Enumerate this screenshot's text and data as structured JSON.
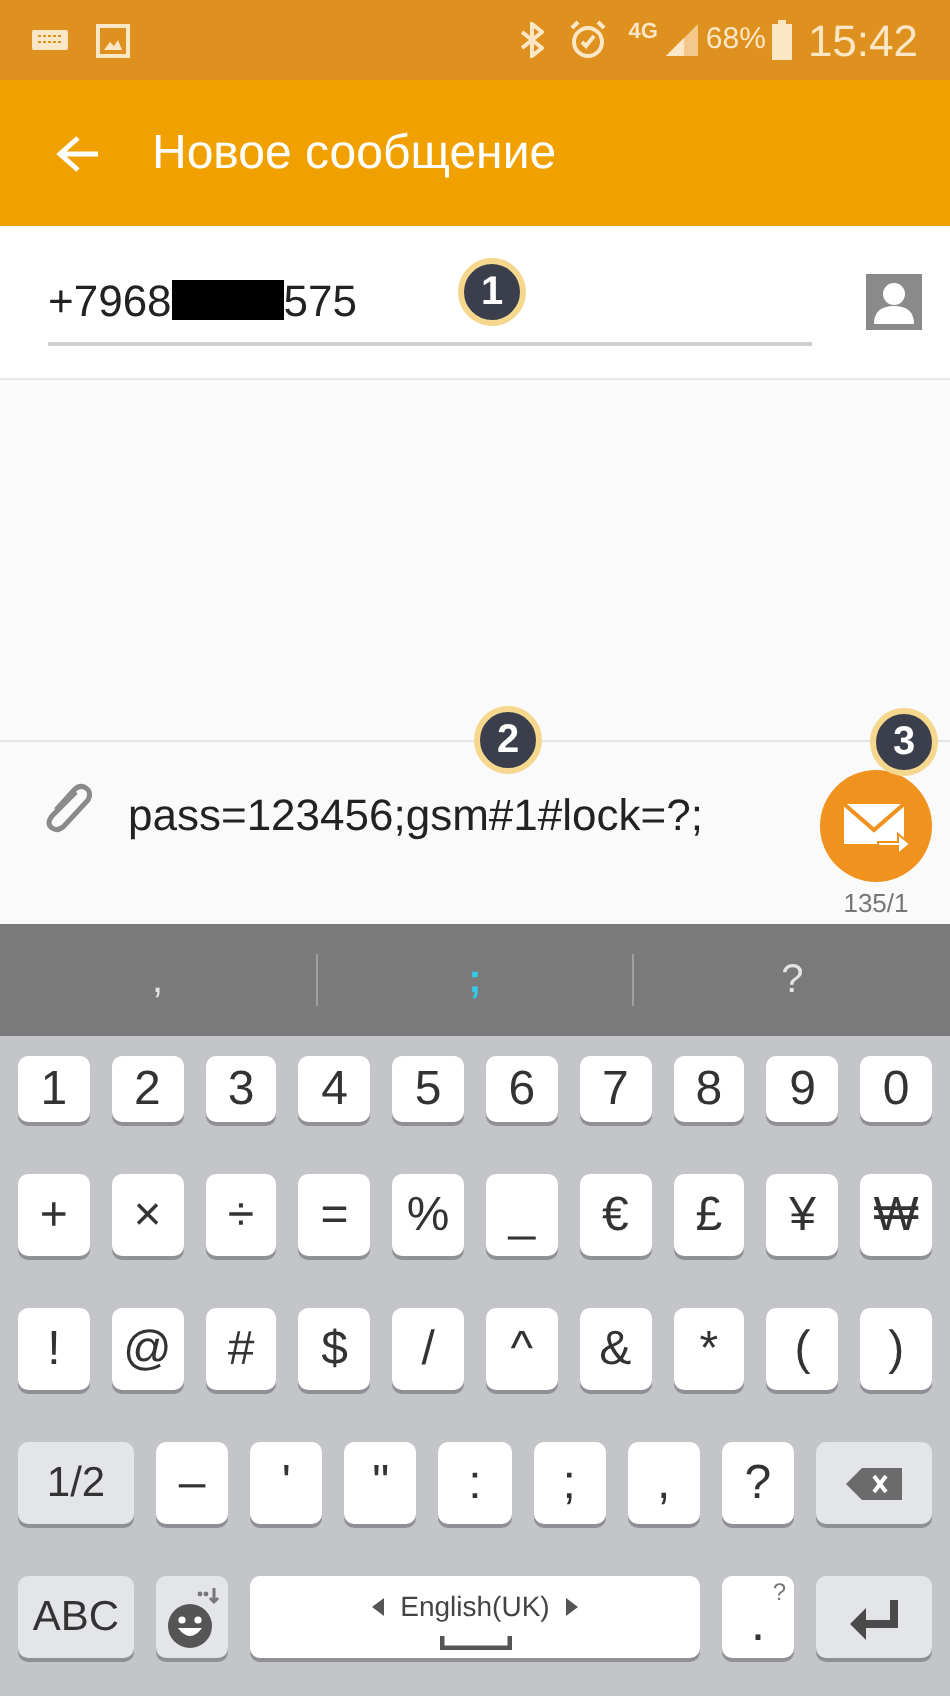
{
  "status_bar": {
    "network": "4G",
    "battery": "68%",
    "time": "15:42"
  },
  "app_bar": {
    "title": "Новое сообщение"
  },
  "recipient": {
    "number_start": "+7968",
    "number_end": "575"
  },
  "composer": {
    "message": "pass=123456;gsm#1#lock=?;",
    "counter": "135/1"
  },
  "annotations": [
    {
      "label": "1"
    },
    {
      "label": "2"
    },
    {
      "label": "3"
    }
  ],
  "suggestions": [
    {
      "text": ",",
      "selected": false
    },
    {
      "text": ";",
      "selected": true
    },
    {
      "text": "?",
      "selected": false
    }
  ],
  "keyboard": {
    "rows": [
      {
        "keys": [
          {
            "label": "1",
            "kind": "char"
          },
          {
            "label": "2",
            "kind": "char"
          },
          {
            "label": "3",
            "kind": "char"
          },
          {
            "label": "4",
            "kind": "char"
          },
          {
            "label": "5",
            "kind": "char"
          },
          {
            "label": "6",
            "kind": "char"
          },
          {
            "label": "7",
            "kind": "char"
          },
          {
            "label": "8",
            "kind": "char"
          },
          {
            "label": "9",
            "kind": "char"
          },
          {
            "label": "0",
            "kind": "char"
          }
        ]
      },
      {
        "keys": [
          {
            "label": "+",
            "kind": "char"
          },
          {
            "label": "×",
            "kind": "char"
          },
          {
            "label": "÷",
            "kind": "char"
          },
          {
            "label": "=",
            "kind": "char"
          },
          {
            "label": "%",
            "kind": "char"
          },
          {
            "label": "_",
            "kind": "char"
          },
          {
            "label": "€",
            "kind": "char"
          },
          {
            "label": "£",
            "kind": "char"
          },
          {
            "label": "¥",
            "kind": "char"
          },
          {
            "label": "₩",
            "kind": "char"
          }
        ]
      },
      {
        "keys": [
          {
            "label": "!",
            "kind": "char"
          },
          {
            "label": "@",
            "kind": "char"
          },
          {
            "label": "#",
            "kind": "char"
          },
          {
            "label": "$",
            "kind": "char"
          },
          {
            "label": "/",
            "kind": "char"
          },
          {
            "label": "^",
            "kind": "char"
          },
          {
            "label": "&",
            "kind": "char"
          },
          {
            "label": "*",
            "kind": "char"
          },
          {
            "label": "(",
            "kind": "char"
          },
          {
            "label": ")",
            "kind": "char"
          }
        ]
      },
      {
        "keys": [
          {
            "label": "1/2",
            "kind": "function"
          },
          {
            "label": "–",
            "kind": "char"
          },
          {
            "label": "'",
            "kind": "char"
          },
          {
            "label": "\"",
            "kind": "char"
          },
          {
            "label": ":",
            "kind": "char"
          },
          {
            "label": ";",
            "kind": "char"
          },
          {
            "label": ",",
            "kind": "char"
          },
          {
            "label": "?",
            "kind": "char"
          },
          {
            "kind": "backspace"
          }
        ]
      },
      {
        "keys": [
          {
            "label": "ABC",
            "kind": "function"
          },
          {
            "kind": "emoji"
          },
          {
            "label": "English(UK)",
            "kind": "space"
          },
          {
            "label": ".",
            "hint": "?",
            "kind": "period"
          },
          {
            "kind": "enter"
          }
        ]
      }
    ]
  }
}
